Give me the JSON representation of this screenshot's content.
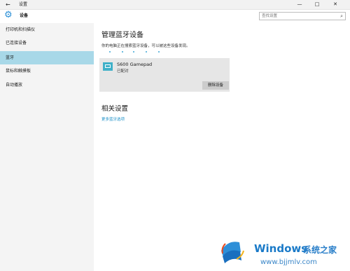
{
  "window": {
    "back_icon": "back-arrow-icon",
    "title": "设置",
    "controls": {
      "min": "—",
      "max": "□",
      "close": "✕"
    }
  },
  "header": {
    "title": "设备",
    "search_placeholder": "查找设置"
  },
  "sidebar": {
    "items": [
      {
        "label": "打印机和扫描仪",
        "active": false
      },
      {
        "label": "已连接设备",
        "active": false
      },
      {
        "label": "蓝牙",
        "active": true
      },
      {
        "label": "鼠标和触摸板",
        "active": false
      },
      {
        "label": "自动播放",
        "active": false
      }
    ]
  },
  "main": {
    "title": "管理蓝牙设备",
    "description": "你的电脑正在搜索蓝牙设备，可以被这些设备发现。",
    "device": {
      "name": "S600 Gamepad",
      "status": "已配对",
      "remove_label": "删除设备",
      "icon": "gamepad-icon"
    },
    "related_title": "相关设置",
    "more_link": "更多蓝牙选项"
  },
  "watermark": {
    "brand": "Windows",
    "cn": "系统之家",
    "url": "www.bjjmlv.com"
  },
  "colors": {
    "accent": "#2b8fd6",
    "active_nav": "#a8d8e8",
    "link": "#1a8fc7"
  }
}
